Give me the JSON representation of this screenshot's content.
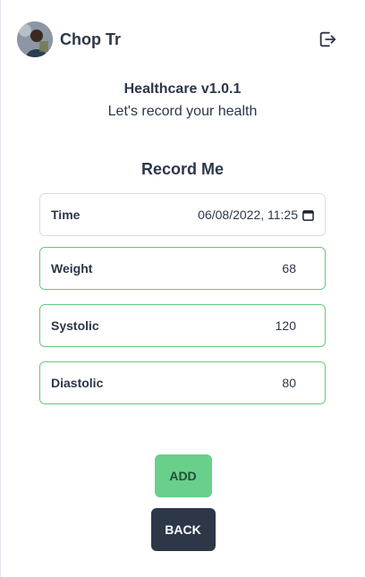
{
  "header": {
    "username": "Chop Tr",
    "avatar_icon": "user-avatar",
    "logout_icon": "logout-icon"
  },
  "intro": {
    "app_title": "Healthcare v1.0.1",
    "subtitle": "Let's record your health"
  },
  "form": {
    "title": "Record Me",
    "fields": {
      "time": {
        "label": "Time",
        "value": "06/08/2022, 11:25"
      },
      "weight": {
        "label": "Weight",
        "value": "68"
      },
      "systolic": {
        "label": "Systolic",
        "value": "120"
      },
      "diastolic": {
        "label": "Diastolic",
        "value": "80"
      }
    }
  },
  "actions": {
    "add_label": "ADD",
    "back_label": "BACK"
  },
  "colors": {
    "accent_green": "#68d08a",
    "field_border_green": "#68c97a",
    "dark": "#2d3748"
  }
}
